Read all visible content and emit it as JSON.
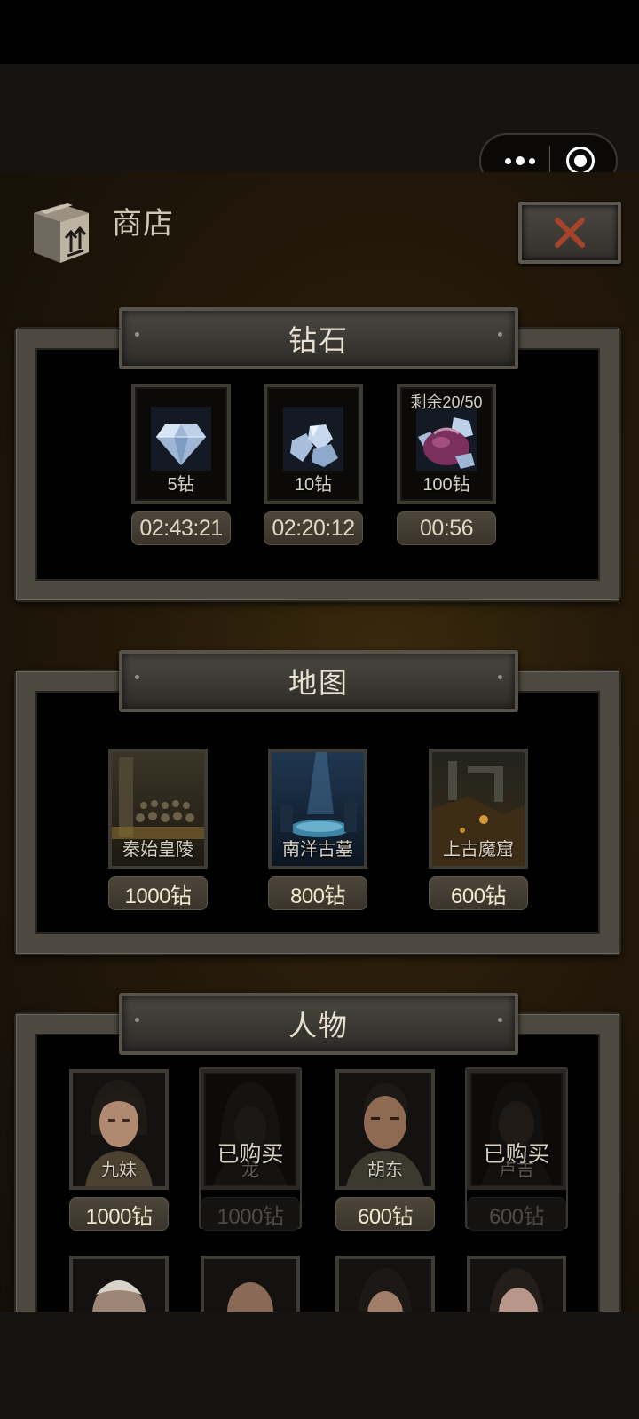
{
  "header": {
    "title": "商店"
  },
  "capsule": {
    "more_icon": "more-dots-icon",
    "close_icon": "target-circle-icon"
  },
  "sections": {
    "diamonds": {
      "title": "钻石",
      "items": [
        {
          "name": "5钻",
          "timer": "02:43:21",
          "remain": ""
        },
        {
          "name": "10钻",
          "timer": "02:20:12",
          "remain": ""
        },
        {
          "name": "100钻",
          "timer": "00:56",
          "remain": "剩余20/50"
        }
      ]
    },
    "maps": {
      "title": "地图",
      "items": [
        {
          "name": "秦始皇陵",
          "price": "1000钻"
        },
        {
          "name": "南洋古墓",
          "price": "800钻"
        },
        {
          "name": "上古魔窟",
          "price": "600钻"
        }
      ]
    },
    "characters": {
      "title": "人物",
      "bought_label": "已购买",
      "items": [
        {
          "name": "九妹",
          "price": "1000钻",
          "bought": false
        },
        {
          "name": "龙",
          "price": "1000钻",
          "bought": true
        },
        {
          "name": "胡东",
          "price": "600钻",
          "bought": false
        },
        {
          "name": "卢吉",
          "price": "600钻",
          "bought": true
        }
      ]
    }
  },
  "colors": {
    "accent_red": "#a5442a",
    "panel_frame": "#4d4840",
    "price_tag": "#4d463a"
  }
}
